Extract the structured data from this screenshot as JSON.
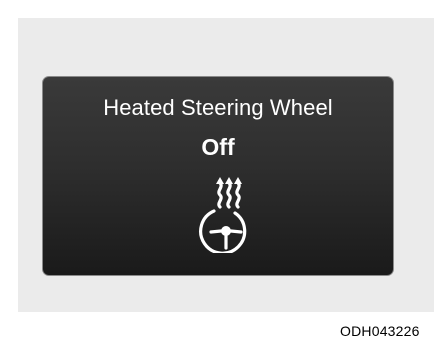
{
  "display": {
    "title": "Heated Steering Wheel",
    "status": "Off",
    "icon": "heated-steering-wheel-icon",
    "text_color": "#ffffff",
    "background_color": "#2b2b2b"
  },
  "caption": {
    "code": "ODH043226"
  }
}
